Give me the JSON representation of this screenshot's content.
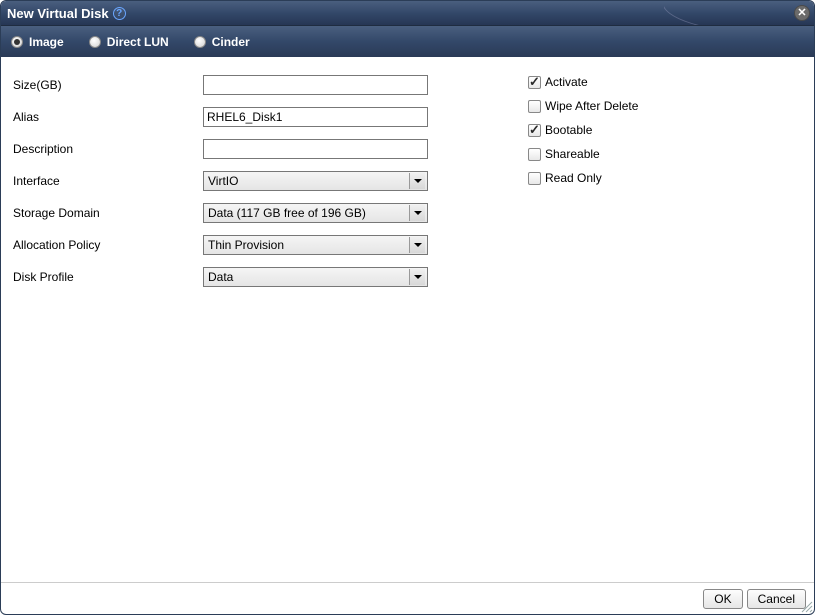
{
  "title": "New Virtual Disk",
  "tabs": [
    {
      "label": "Image",
      "selected": true
    },
    {
      "label": "Direct LUN",
      "selected": false
    },
    {
      "label": "Cinder",
      "selected": false
    }
  ],
  "fields": {
    "size": {
      "label": "Size(GB)",
      "value": ""
    },
    "alias": {
      "label": "Alias",
      "value": "RHEL6_Disk1"
    },
    "description": {
      "label": "Description",
      "value": ""
    },
    "interface": {
      "label": "Interface",
      "value": "VirtIO"
    },
    "storage_domain": {
      "label": "Storage Domain",
      "value": "Data (117 GB free of 196 GB)"
    },
    "allocation_policy": {
      "label": "Allocation Policy",
      "value": "Thin Provision"
    },
    "disk_profile": {
      "label": "Disk Profile",
      "value": "Data"
    }
  },
  "checks": {
    "activate": {
      "label": "Activate",
      "checked": true
    },
    "wipe": {
      "label": "Wipe After Delete",
      "checked": false
    },
    "bootable": {
      "label": "Bootable",
      "checked": true
    },
    "shareable": {
      "label": "Shareable",
      "checked": false
    },
    "readonly": {
      "label": "Read Only",
      "checked": false
    }
  },
  "buttons": {
    "ok": "OK",
    "cancel": "Cancel"
  }
}
